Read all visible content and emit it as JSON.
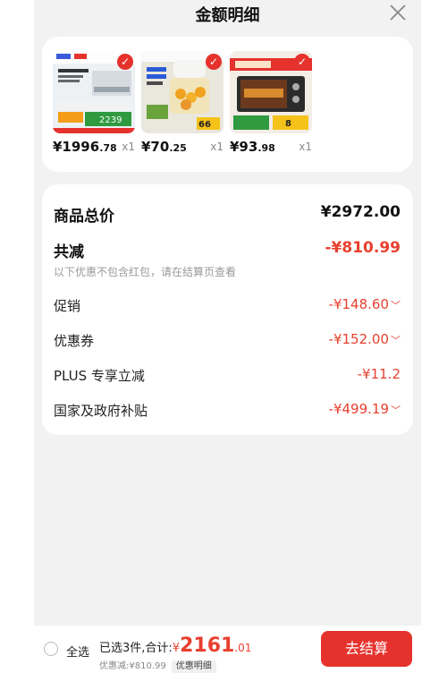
{
  "header": {
    "title": "金额明细"
  },
  "products": [
    {
      "price_int": "¥1996",
      "price_dec": ".78",
      "qty": "x1",
      "badge": "2239"
    },
    {
      "price_int": "¥70",
      "price_dec": ".25",
      "qty": "x1",
      "badge": "66"
    },
    {
      "price_int": "¥93",
      "price_dec": ".98",
      "qty": "x1",
      "badge": "8"
    }
  ],
  "summary": {
    "total_label": "商品总价",
    "total_value": "¥2972.00",
    "discount_label": "共减",
    "discount_value": "-¥810.99",
    "note": "以下优惠不包含红包，请在结算页查看",
    "items": [
      {
        "label": "促销",
        "value": "-¥148.60",
        "chev": "﹀"
      },
      {
        "label": "优惠券",
        "value": "-¥152.00",
        "chev": "﹀"
      },
      {
        "label": "PLUS 专享立减",
        "value": "-¥11.2",
        "chev": ""
      },
      {
        "label": "国家及政府补贴",
        "value": "-¥499.19",
        "chev": "﹀"
      }
    ]
  },
  "bottom": {
    "select_all": "全选",
    "selected_text": "已选3件,合计:",
    "currency": "¥",
    "amount_int": "2161",
    "amount_dec": ".01",
    "saved_text": "优惠减:¥810.99",
    "detail_tag": "优惠明细",
    "checkout": "去结算"
  },
  "colors": {
    "accent": "#e5322d",
    "price_red": "#e8402f",
    "background": "#f2f2f2"
  }
}
